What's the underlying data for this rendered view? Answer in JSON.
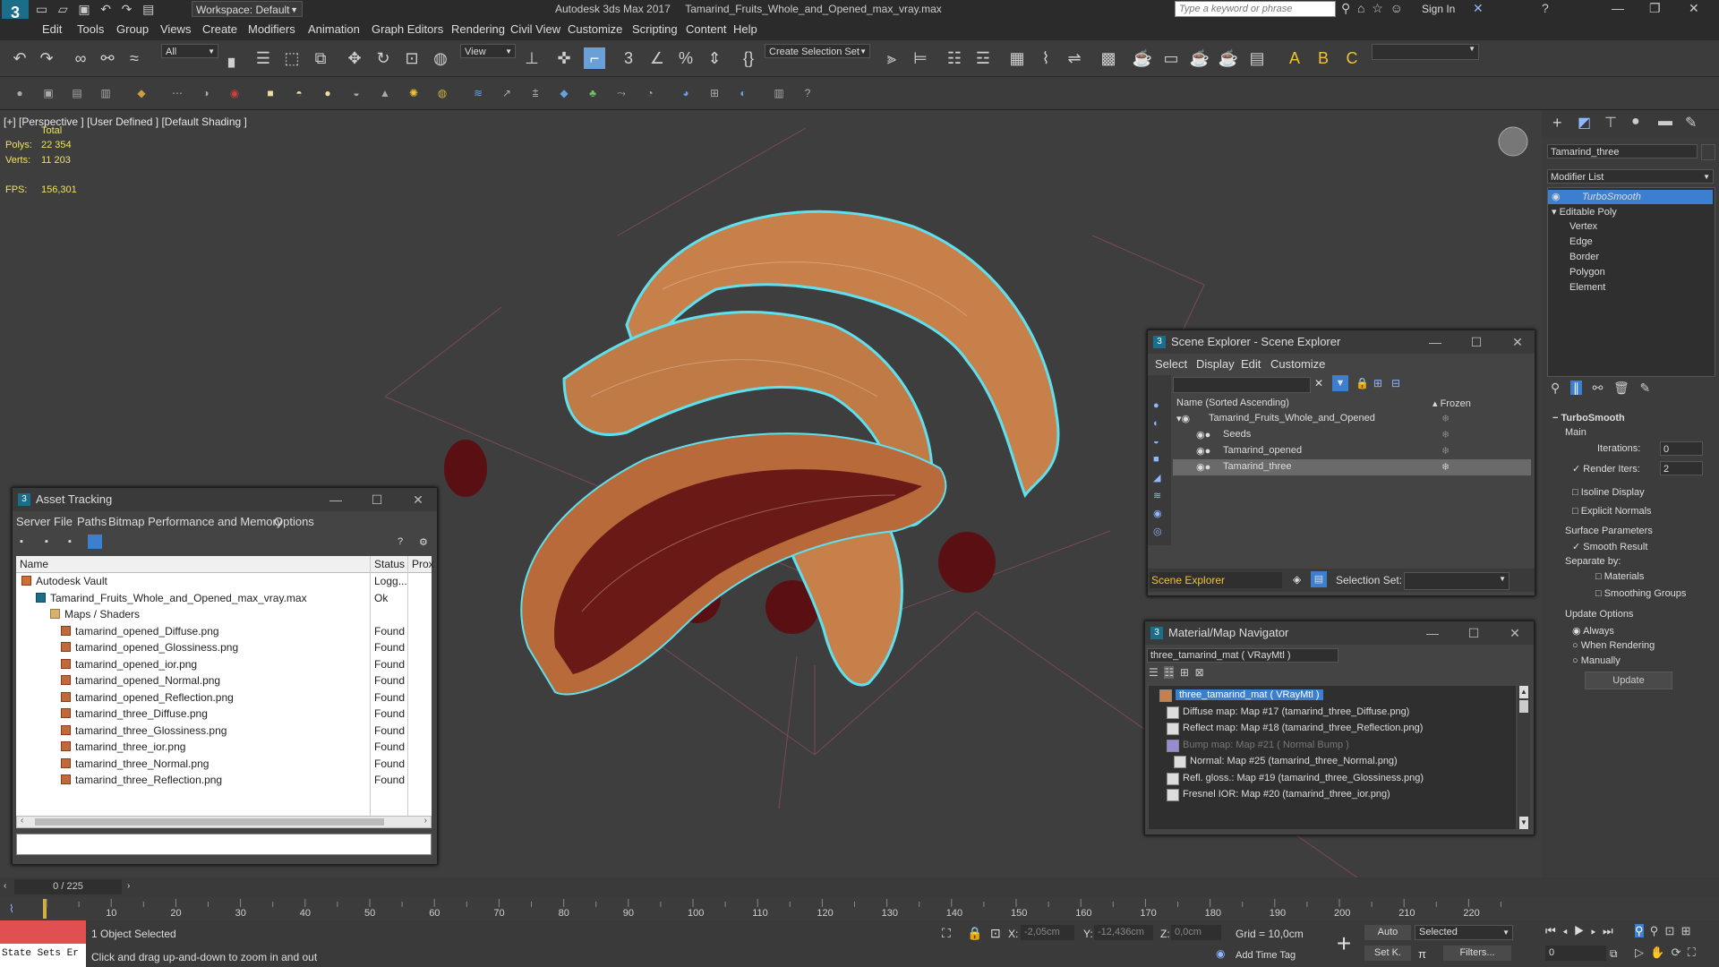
{
  "titlebar": {
    "app_title": "Autodesk 3ds Max 2017",
    "file_title": "Tamarind_Fruits_Whole_and_Opened_max_vray.max",
    "workspace_label": "Workspace: Default",
    "search_placeholder": "Type a keyword or phrase",
    "sign_in": "Sign In",
    "app_logo": "3"
  },
  "menu": [
    "Edit",
    "Tools",
    "Group",
    "Views",
    "Create",
    "Modifiers",
    "Animation",
    "Graph Editors",
    "Rendering",
    "Civil View",
    "Customize",
    "Scripting",
    "Content",
    "Help"
  ],
  "toolbar": {
    "filter_value": "All",
    "view_value": "View",
    "selection_set_label": "Create Selection Set"
  },
  "viewport": {
    "label_plus": "[+]",
    "label_view": "[Perspective ]",
    "label_user": "[User Defined ]",
    "label_shading": "[Default Shading ]",
    "stats_total": "Total",
    "polys_label": "Polys:",
    "polys_value": "22 354",
    "verts_label": "Verts:",
    "verts_value": "11 203",
    "fps_label": "FPS:",
    "fps_value": "156,301"
  },
  "command_panel": {
    "object_name": "Tamarind_three",
    "modifier_list": "Modifier List",
    "stack": [
      "TurboSmooth",
      "Editable Poly",
      "Vertex",
      "Edge",
      "Border",
      "Polygon",
      "Element"
    ],
    "rollout_title": "TurboSmooth",
    "main_label": "Main",
    "iterations_label": "Iterations:",
    "iterations_value": "0",
    "render_iters_label": "Render Iters:",
    "render_iters_value": "2",
    "isoline_label": "Isoline Display",
    "explicit_normals_label": "Explicit Normals",
    "surface_params": "Surface Parameters",
    "smooth_result": "Smooth Result",
    "separate_by": "Separate by:",
    "materials": "Materials",
    "smoothing_groups": "Smoothing Groups",
    "update_options": "Update Options",
    "always": "Always",
    "when_rendering": "When Rendering",
    "manually": "Manually",
    "update_button": "Update"
  },
  "scene_explorer": {
    "title": "Scene Explorer - Scene Explorer",
    "menu": [
      "Select",
      "Display",
      "Edit",
      "Customize"
    ],
    "col_name": "Name (Sorted Ascending)",
    "col_frozen": "Frozen",
    "rows": [
      "Tamarind_Fruits_Whole_and_Opened",
      "Seeds",
      "Tamarind_opened",
      "Tamarind_three"
    ],
    "footer_name": "Scene Explorer",
    "selection_set_label": "Selection Set:"
  },
  "asset_tracking": {
    "title": "Asset Tracking",
    "menu": [
      "Server",
      "File",
      "Paths",
      "Bitmap Performance and Memory",
      "Options"
    ],
    "col_name": "Name",
    "col_status": "Status",
    "col_prox": "Prox",
    "rows": [
      {
        "name": "Autodesk Vault",
        "status": "Logg...",
        "indent": 1
      },
      {
        "name": "Tamarind_Fruits_Whole_and_Opened_max_vray.max",
        "status": "Ok",
        "indent": 2
      },
      {
        "name": "Maps / Shaders",
        "status": "",
        "indent": 3
      },
      {
        "name": "tamarind_opened_Diffuse.png",
        "status": "Found",
        "indent": 4
      },
      {
        "name": "tamarind_opened_Glossiness.png",
        "status": "Found",
        "indent": 4
      },
      {
        "name": "tamarind_opened_ior.png",
        "status": "Found",
        "indent": 4
      },
      {
        "name": "tamarind_opened_Normal.png",
        "status": "Found",
        "indent": 4
      },
      {
        "name": "tamarind_opened_Reflection.png",
        "status": "Found",
        "indent": 4
      },
      {
        "name": "tamarind_three_Diffuse.png",
        "status": "Found",
        "indent": 4
      },
      {
        "name": "tamarind_three_Glossiness.png",
        "status": "Found",
        "indent": 4
      },
      {
        "name": "tamarind_three_ior.png",
        "status": "Found",
        "indent": 4
      },
      {
        "name": "tamarind_three_Normal.png",
        "status": "Found",
        "indent": 4
      },
      {
        "name": "tamarind_three_Reflection.png",
        "status": "Found",
        "indent": 4
      }
    ]
  },
  "material_navigator": {
    "title": "Material/Map Navigator",
    "current": "three_tamarind_mat  ( VRayMtl )",
    "rows": [
      {
        "text": "three_tamarind_mat  ( VRayMtl )",
        "level": 0
      },
      {
        "text": "Diffuse map: Map #17 (tamarind_three_Diffuse.png)",
        "level": 1
      },
      {
        "text": "Reflect map: Map #18 (tamarind_three_Reflection.png)",
        "level": 1
      },
      {
        "text": "Bump map: Map #21  ( Normal Bump )",
        "level": 1
      },
      {
        "text": "Normal: Map #25 (tamarind_three_Normal.png)",
        "level": 2
      },
      {
        "text": "Refl. gloss.: Map #19 (tamarind_three_Glossiness.png)",
        "level": 1
      },
      {
        "text": "Fresnel IOR: Map #20 (tamarind_three_ior.png)",
        "level": 1
      }
    ]
  },
  "timeline": {
    "frame": "0 / 225",
    "ticks": [
      "10",
      "20",
      "30",
      "40",
      "50",
      "60",
      "70",
      "80",
      "90",
      "100",
      "110",
      "120",
      "130",
      "140",
      "150",
      "160",
      "170",
      "180",
      "190",
      "200",
      "210",
      "220"
    ]
  },
  "status": {
    "state_sets": "State Sets Er",
    "selected": "1 Object Selected",
    "prompt": "Click and drag up-and-down to zoom in and out",
    "x_label": "X:",
    "x_value": "-2,05cm",
    "y_label": "Y:",
    "y_value": "-12,436cm",
    "z_label": "Z:",
    "z_value": "0,0cm",
    "grid": "Grid = 10,0cm",
    "add_time_tag": "Add Time Tag",
    "auto": "Auto",
    "set_k": "Set K.",
    "selected_dropdown": "Selected",
    "filters": "Filters...",
    "frame_field": "0"
  },
  "colors": {
    "accent": "#3c7fd0",
    "selection_outline": "#5fe0ee",
    "tamarind_shell": "#c8804a",
    "seed": "#5a0f12"
  }
}
